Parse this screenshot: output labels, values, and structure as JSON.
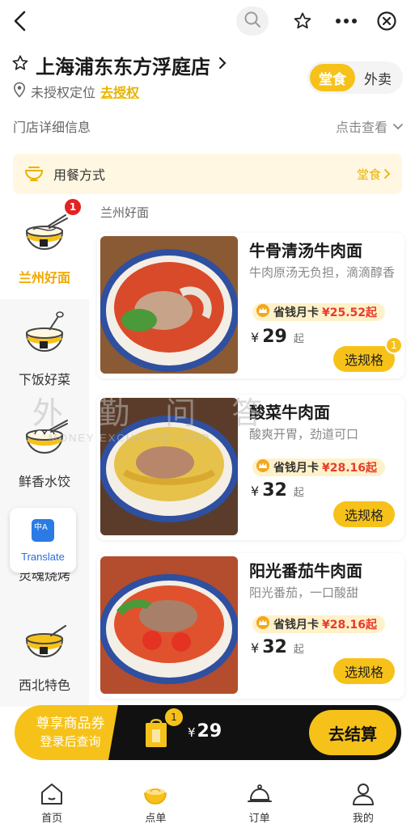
{
  "topbar": {
    "back_icon": "back-chevron-icon",
    "search_icon": "search-icon",
    "favorite_icon": "star-icon",
    "more_icon": "more-dots-icon",
    "close_icon": "close-circle-icon"
  },
  "store": {
    "name": "上海浦东东方浮庭店",
    "location_status": "未授权定位",
    "authorize_label": "去授权",
    "detail_label": "门店详细信息",
    "view_label": "点击查看"
  },
  "mode_toggle": {
    "dine_in": "堂食",
    "takeout": "外卖",
    "active": "堂食"
  },
  "dining": {
    "label": "用餐方式",
    "value": "堂食"
  },
  "sidebar": {
    "items": [
      {
        "label": "兰州好面",
        "badge": "1",
        "active": true
      },
      {
        "label": "下饭好菜"
      },
      {
        "label": "鲜香水饺"
      },
      {
        "label": "灵魂烧烤"
      },
      {
        "label": "西北特色"
      }
    ]
  },
  "translate": {
    "label": "Translate",
    "icon_text": "中A"
  },
  "watermark": {
    "zh": "外 勤 问 答",
    "en": "MONEY EXCHANGE LABO"
  },
  "menu": {
    "section_title": "兰州好面",
    "items": [
      {
        "name": "牛骨清汤牛肉面",
        "desc": "牛肉原汤无负担，滴滴醇香",
        "promo_tag": "省钱月卡",
        "promo_amount": "¥25.52起",
        "currency": "¥",
        "price": "29",
        "price_suffix": "起",
        "spec_label": "选规格",
        "spec_count": "1"
      },
      {
        "name": "酸菜牛肉面",
        "desc": "酸爽开胃，劲道可口",
        "promo_tag": "省钱月卡",
        "promo_amount": "¥28.16起",
        "currency": "¥",
        "price": "32",
        "price_suffix": "起",
        "spec_label": "选规格"
      },
      {
        "name": "阳光番茄牛肉面",
        "desc": "阳光番茄，一口酸甜",
        "promo_tag": "省钱月卡",
        "promo_amount": "¥28.16起",
        "currency": "¥",
        "price": "32",
        "price_suffix": "起",
        "spec_label": "选规格"
      }
    ]
  },
  "checkout": {
    "coupon_line1": "尊享商品券",
    "coupon_line2": "登录后查询",
    "cart_count": "1",
    "currency": "¥",
    "total": "29",
    "checkout_label": "去结算"
  },
  "tabbar": {
    "items": [
      {
        "label": "首页",
        "icon": "home-icon"
      },
      {
        "label": "点单",
        "icon": "noodle-bowl-icon"
      },
      {
        "label": "订单",
        "icon": "order-cloche-icon"
      },
      {
        "label": "我的",
        "icon": "profile-icon"
      }
    ]
  },
  "colors": {
    "accent": "#f6c21a",
    "promo_price": "#e53c2c",
    "badge": "#e52222"
  }
}
